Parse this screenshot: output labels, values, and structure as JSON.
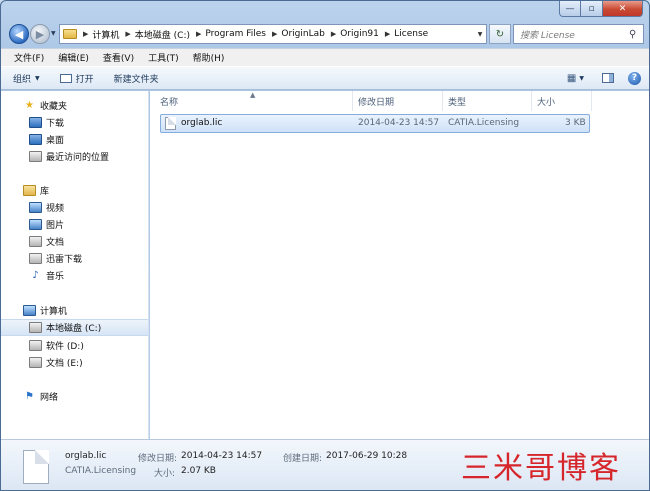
{
  "window": {
    "caption": {
      "minimize": "—",
      "maximize": "▫",
      "close": "✕"
    }
  },
  "address": {
    "crumbs": [
      "计算机",
      "本地磁盘 (C:)",
      "Program Files",
      "OriginLab",
      "Origin91",
      "License"
    ],
    "search_placeholder": "搜索 License"
  },
  "menu": [
    "文件(F)",
    "编辑(E)",
    "查看(V)",
    "工具(T)",
    "帮助(H)"
  ],
  "toolbar": {
    "organize": "组织",
    "open": "打开",
    "new_folder": "新建文件夹"
  },
  "nav": {
    "favorites": {
      "label": "收藏夹",
      "items": [
        "下载",
        "桌面",
        "最近访问的位置"
      ]
    },
    "libraries": {
      "label": "库",
      "items": [
        "视频",
        "图片",
        "文档",
        "迅雷下载",
        "音乐"
      ]
    },
    "computer": {
      "label": "计算机",
      "items": [
        "本地磁盘 (C:)",
        "软件 (D:)",
        "文档 (E:)"
      ]
    },
    "network": {
      "label": "网络"
    }
  },
  "columns": {
    "name": "名称",
    "modified": "修改日期",
    "type": "类型",
    "size": "大小"
  },
  "files": [
    {
      "name": "orglab.lic",
      "modified": "2014-04-23 14:57",
      "type": "CATIA.Licensing",
      "size": "3 KB"
    }
  ],
  "details": {
    "name": "orglab.lic",
    "type": "CATIA.Licensing",
    "modified_label": "修改日期:",
    "modified": "2014-04-23 14:57",
    "size_label": "大小:",
    "size": "2.07 KB",
    "created_label": "创建日期:",
    "created": "2017-06-29 10:28"
  },
  "watermark": "三米哥博客"
}
